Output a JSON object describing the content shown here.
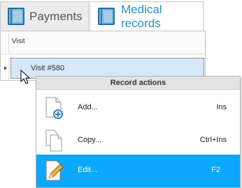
{
  "tabs": [
    {
      "label": "Payments",
      "icon": "book-icon",
      "active": false
    },
    {
      "label": "Medical records",
      "icon": "book-icon",
      "active": true
    }
  ],
  "grid": {
    "column_header": "Visit",
    "rows": [
      {
        "label": "Visit #580",
        "selected": true
      }
    ]
  },
  "context_menu": {
    "title": "Record actions",
    "items": [
      {
        "label": "Add...",
        "shortcut": "Ins",
        "icon": "add-document-icon",
        "highlighted": false
      },
      {
        "label": "Copy...",
        "shortcut": "Ctrl+Ins",
        "icon": "copy-documents-icon",
        "highlighted": false
      },
      {
        "label": "Edit...",
        "shortcut": "F2",
        "icon": "edit-pencil-icon",
        "highlighted": true
      }
    ]
  },
  "colors": {
    "active_tab_text": "#2b8fd0",
    "selected_row": "#d6e8f7",
    "menu_highlight": "#0ca8ff"
  }
}
